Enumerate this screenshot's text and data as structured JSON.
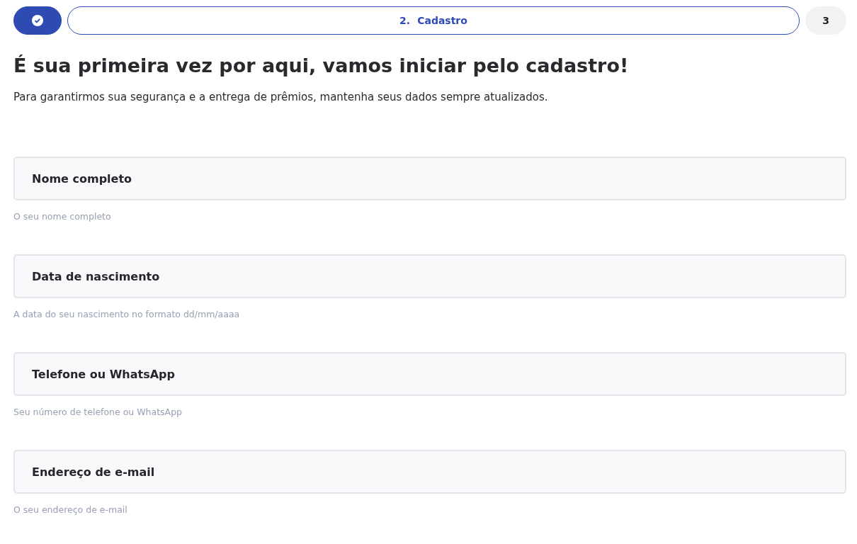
{
  "steps": [
    {
      "kind": "done"
    },
    {
      "kind": "current",
      "number": "2.",
      "label": "Cadastro"
    },
    {
      "kind": "upcoming",
      "number": "3"
    }
  ],
  "heading": "É sua primeira vez por aqui, vamos iniciar pelo cadastro!",
  "subtitle": "Para garantirmos sua segurança e a entrega de prêmios, mantenha seus dados sempre atualizados.",
  "fields": [
    {
      "placeholder": "Nome completo",
      "hint": "O seu nome completo"
    },
    {
      "placeholder": "Data de nascimento",
      "hint": "A data do seu nascimento no formato dd/mm/aaaa"
    },
    {
      "placeholder": "Telefone ou WhatsApp",
      "hint": "Seu número de telefone ou WhatsApp"
    },
    {
      "placeholder": "Endereço de e-mail",
      "hint": "O seu endereço de e-mail"
    }
  ]
}
